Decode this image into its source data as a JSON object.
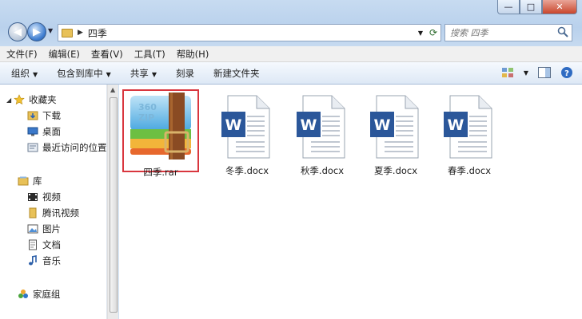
{
  "window": {
    "minimize": "—",
    "maximize": "□",
    "close": "✕"
  },
  "address": {
    "path": "四季"
  },
  "search": {
    "placeholder": "搜索 四季"
  },
  "menu": [
    "文件(F)",
    "编辑(E)",
    "查看(V)",
    "工具(T)",
    "帮助(H)"
  ],
  "toolbar": {
    "organize": "组织",
    "include_in_library": "包含到库中",
    "share": "共享",
    "burn": "刻录",
    "new_folder": "新建文件夹"
  },
  "navigation": {
    "favorites": "收藏夹",
    "downloads": "下载",
    "desktop": "桌面",
    "recent": "最近访问的位置",
    "libraries": "库",
    "videos": "视频",
    "tencent_video": "腾讯视频",
    "pictures": "图片",
    "documents": "文档",
    "music": "音乐",
    "homegroup": "家庭组"
  },
  "files": [
    {
      "name": "四季.rar",
      "type": "archive",
      "icon": "archive-icon",
      "archive_text": "360\nZIP",
      "selected": true
    },
    {
      "name": "冬季.docx",
      "type": "word",
      "icon": "word-doc-icon",
      "badge": "W"
    },
    {
      "name": "秋季.docx",
      "type": "word",
      "icon": "word-doc-icon",
      "badge": "W"
    },
    {
      "name": "夏季.docx",
      "type": "word",
      "icon": "word-doc-icon",
      "badge": "W"
    },
    {
      "name": "春季.docx",
      "type": "word",
      "icon": "word-doc-icon",
      "badge": "W"
    }
  ],
  "colors": {
    "selection_border": "#d9363e",
    "word_blue": "#2b579a",
    "folder_yellow": "#e8c158"
  }
}
